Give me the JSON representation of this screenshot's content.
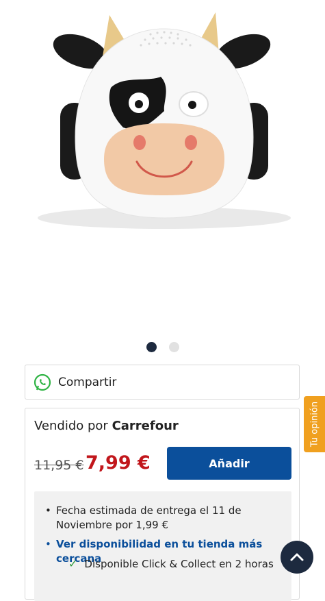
{
  "gallery": {
    "slide_count": 2,
    "active_index": 0
  },
  "share": {
    "label": "Compartir",
    "icon": "whatsapp-icon"
  },
  "seller": {
    "prefix": "Vendido por",
    "name": "Carrefour"
  },
  "price": {
    "old": "11,95 €",
    "current": "7,99 €"
  },
  "add_button": {
    "label": "Añadir"
  },
  "delivery": {
    "estimate": "Fecha estimada de entrega el 11 de Noviembre por 1,99 €",
    "store_link": "Ver disponibilidad en tu tienda más cercana",
    "click_collect": "Disponible Click & Collect en 2 horas"
  },
  "feedback_tab": {
    "label": "Tu opinión"
  },
  "colors": {
    "brand_blue": "#0b4f9b",
    "price_red": "#c1161b",
    "feedback_orange": "#f0a01f",
    "dark_navy": "#1d2a3f"
  }
}
